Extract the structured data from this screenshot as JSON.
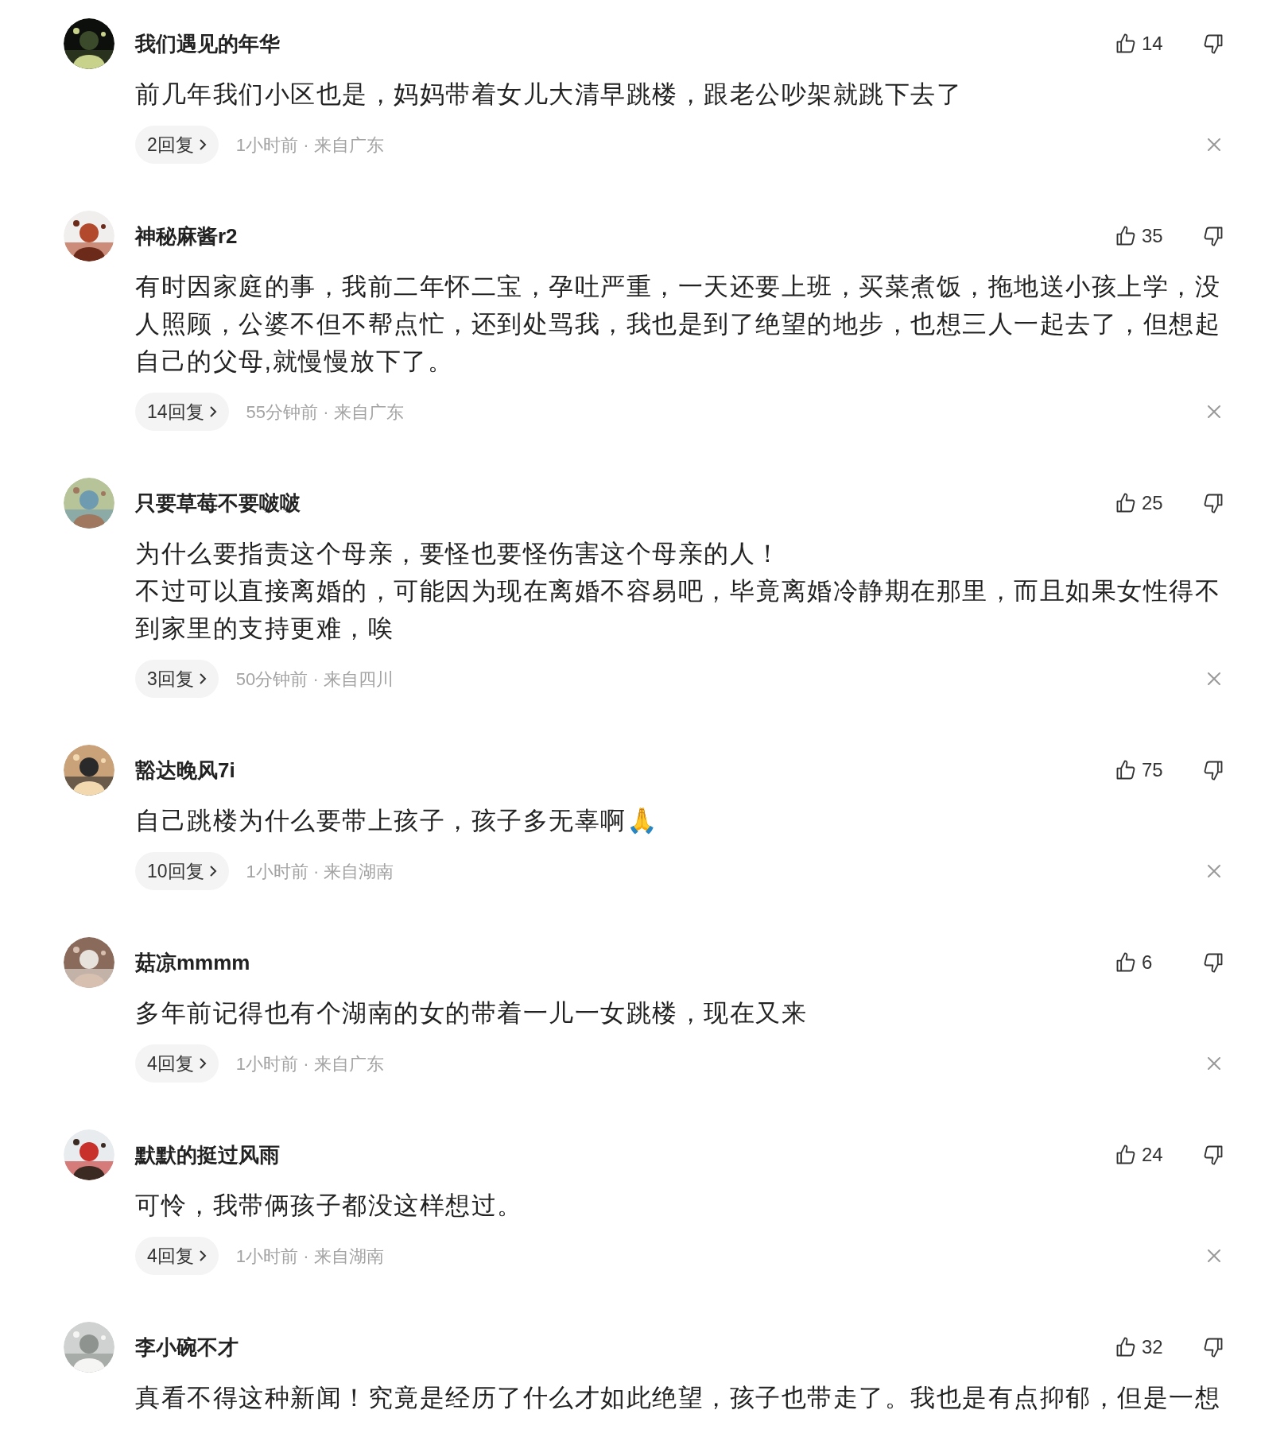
{
  "comments": [
    {
      "name": "我们遇见的年华",
      "likes": "14",
      "body": [
        "前几年我们小区也是，妈妈带着女儿大清早跳楼，跟老公吵架就跳下去了"
      ],
      "replies": "2回复",
      "meta": "1小时前 · 来自广东"
    },
    {
      "name": "神秘麻酱r2",
      "likes": "35",
      "body": [
        "有时因家庭的事，我前二年怀二宝，孕吐严重，一天还要上班，买菜煮饭，拖地送小孩上学，没人照顾，公婆不但不帮点忙，还到处骂我，我也是到了绝望的地步，也想三人一起去了，但想起自己的父母,就慢慢放下了。"
      ],
      "replies": "14回复",
      "meta": "55分钟前 · 来自广东"
    },
    {
      "name": "只要草莓不要啵啵",
      "likes": "25",
      "body": [
        "为什么要指责这个母亲，要怪也要怪伤害这个母亲的人！",
        "不过可以直接离婚的，可能因为现在离婚不容易吧，毕竟离婚冷静期在那里，而且如果女性得不到家里的支持更难，唉"
      ],
      "replies": "3回复",
      "meta": "50分钟前 · 来自四川"
    },
    {
      "name": "豁达晚风7i",
      "likes": "75",
      "body": [
        "自己跳楼为什么要带上孩子，孩子多无辜啊🙏"
      ],
      "replies": "10回复",
      "meta": "1小时前 · 来自湖南"
    },
    {
      "name": "菇凉mmmm",
      "likes": "6",
      "body": [
        "多年前记得也有个湖南的女的带着一儿一女跳楼，现在又来"
      ],
      "replies": "4回复",
      "meta": "1小时前 · 来自广东"
    },
    {
      "name": "默默的挺过风雨",
      "likes": "24",
      "body": [
        "可怜，我带俩孩子都没这样想过。"
      ],
      "replies": "4回复",
      "meta": "1小时前 · 来自湖南"
    },
    {
      "name": "李小碗不才",
      "likes": "32",
      "body": [
        "真看不得这种新闻！究竟是经历了什么才如此绝望，孩子也带走了。我也是有点抑郁，但是一想"
      ]
    }
  ]
}
